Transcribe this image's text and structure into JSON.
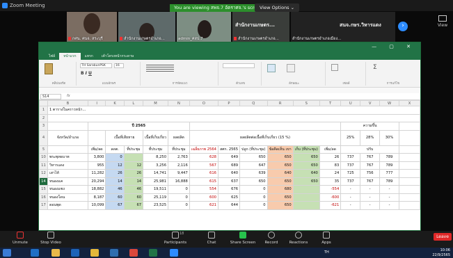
{
  "zoom": {
    "app_title": "Zoom Meeting",
    "banner": "You are viewing สพจ.7 อัตราศจ.'s screen",
    "view_options": "View Options ⌄",
    "view_label": "View",
    "participants": [
      {
        "name": "กศน. ศนจ. สระบุรี",
        "muted": true
      },
      {
        "name": "สำนักงานเกษตรอำเภอ...",
        "muted": true
      },
      {
        "name": "admin_ศสป.7",
        "muted": false
      },
      {
        "name": "สำนักงานเกษตรอำเภอ...",
        "muted": true,
        "big": "สำนักงานเกษตร..."
      },
      {
        "name": "สำนักงานเกษตรอำเภอเมือง...",
        "muted": false,
        "big": "สนจ.กษร.วิหารแดง"
      }
    ],
    "toolbar": {
      "unmute": "Unmute",
      "stop_video": "Stop Video",
      "participants": "Participants",
      "participants_count": "18",
      "chat": "Chat",
      "share_screen": "Share Screen",
      "record": "Record",
      "reactions": "Reactions",
      "apps": "Apps",
      "leave": "Leave"
    }
  },
  "excel": {
    "tabs": [
      "ไฟล์",
      "หน้าแรก",
      "แทรก",
      "เค้าโครงหน้ากระดาษ"
    ],
    "active_tab": "หน้าแรก",
    "font_name": "TH SarabunPSK",
    "font_size": "16",
    "ribbon_groups": [
      "คลิปบอร์ด",
      "แบบอักษร",
      "การจัดแนว",
      "ตัวเลข",
      "ลักษณะ",
      "เซลล์",
      "การแก้ไข"
    ],
    "name_box": "S14",
    "fx": "fx",
    "columns": [
      "A",
      "B",
      "I",
      "K",
      "L",
      "M",
      "N",
      "O",
      "P",
      "Q",
      "R",
      "S",
      "T",
      "U",
      "V",
      "W",
      "X"
    ],
    "title_row": "1  ตารางในคราวหน้า...",
    "header_year": "ปี 2565",
    "h_damaged": "เนื้อที่เสียหาย",
    "h_harvest": "เนื้อที่เก็บเกี่ยว",
    "h_yield": "ผลผลิต",
    "h_yield_per": "ผลผลิตต่อเนื้อที่เก็บเกี่ยว (15 %)",
    "h_increase": "ความขึ้น",
    "h_province": "จังหวัด/อำเภอ",
    "h_plant_rai": "เพิ่ม/ลด",
    "h_rai": "ลดต.",
    "h_meeting": "ที่ประชุม",
    "h_avg": "เฉลี่ยภาพ 2564",
    "h_stat": "สศก. 2565",
    "h_plant": "ปลูก (ที่ประชุม)",
    "h_proposal": "ข้อคิดเห็น เขา",
    "h_harvest2": "เก็บ (ที่ประชุม)",
    "h_change": "เพิ่ม/ลด",
    "h_pct": [
      "25%",
      "28%",
      "30%"
    ],
    "h_adj": "ปรับ",
    "rows": [
      {
        "r": "10",
        "name": "พระพุทธบาท",
        "a": "3,800",
        "b": "0",
        "c": "",
        "d": "8,250",
        "e": "2,763",
        "f": "628",
        "g": "649",
        "h": "650",
        "i": "650",
        "j": "650",
        "k": "26",
        "l": "737",
        "m": "767",
        "n": "789"
      },
      {
        "r": "11",
        "name": "วิหารแดง",
        "a": "955",
        "b": "12",
        "c": "12",
        "d": "3,256",
        "e": "2,116",
        "f": "567",
        "g": "689",
        "h": "647",
        "i": "650",
        "j": "650",
        "k": "83",
        "l": "737",
        "m": "767",
        "n": "789"
      },
      {
        "r": "12",
        "name": "เสาไห้",
        "a": "11,282",
        "b": "26",
        "c": "26",
        "d": "14,741",
        "e": "9,447",
        "f": "616",
        "g": "640",
        "h": "639",
        "i": "640",
        "j": "640",
        "k": "24",
        "l": "725",
        "m": "756",
        "n": "777"
      },
      {
        "r": "14",
        "name": "หนองแค",
        "a": "20,294",
        "b": "14",
        "c": "14",
        "d": "25,981",
        "e": "16,888",
        "f": "615",
        "g": "637",
        "h": "650",
        "i": "650",
        "j": "650",
        "k": "35",
        "l": "737",
        "m": "767",
        "n": "789"
      },
      {
        "r": "15",
        "name": "หนองแซง",
        "a": "18,882",
        "b": "46",
        "c": "46",
        "d": "19,511",
        "e": "0",
        "f": "554",
        "g": "676",
        "h": "0",
        "i": "680",
        "j": "",
        "k": "-554",
        "l": "-",
        "m": "-",
        "n": "-"
      },
      {
        "r": "16",
        "name": "หนองโดน",
        "a": "8,187",
        "b": "60",
        "c": "60",
        "d": "25,119",
        "e": "0",
        "f": "600",
        "g": "625",
        "h": "0",
        "i": "650",
        "j": "",
        "k": "-600",
        "l": "-",
        "m": "-",
        "n": "-"
      },
      {
        "r": "17",
        "name": "ดอนพุด",
        "a": "10,099",
        "b": "67",
        "c": "67",
        "d": "23,525",
        "e": "0",
        "f": "621",
        "g": "644",
        "h": "0",
        "i": "650",
        "j": "",
        "k": "-621",
        "l": "-",
        "m": "-",
        "n": "-"
      }
    ]
  },
  "taskbar": {
    "time": "10:06",
    "date": "22/9/2565",
    "lang": "TH"
  }
}
